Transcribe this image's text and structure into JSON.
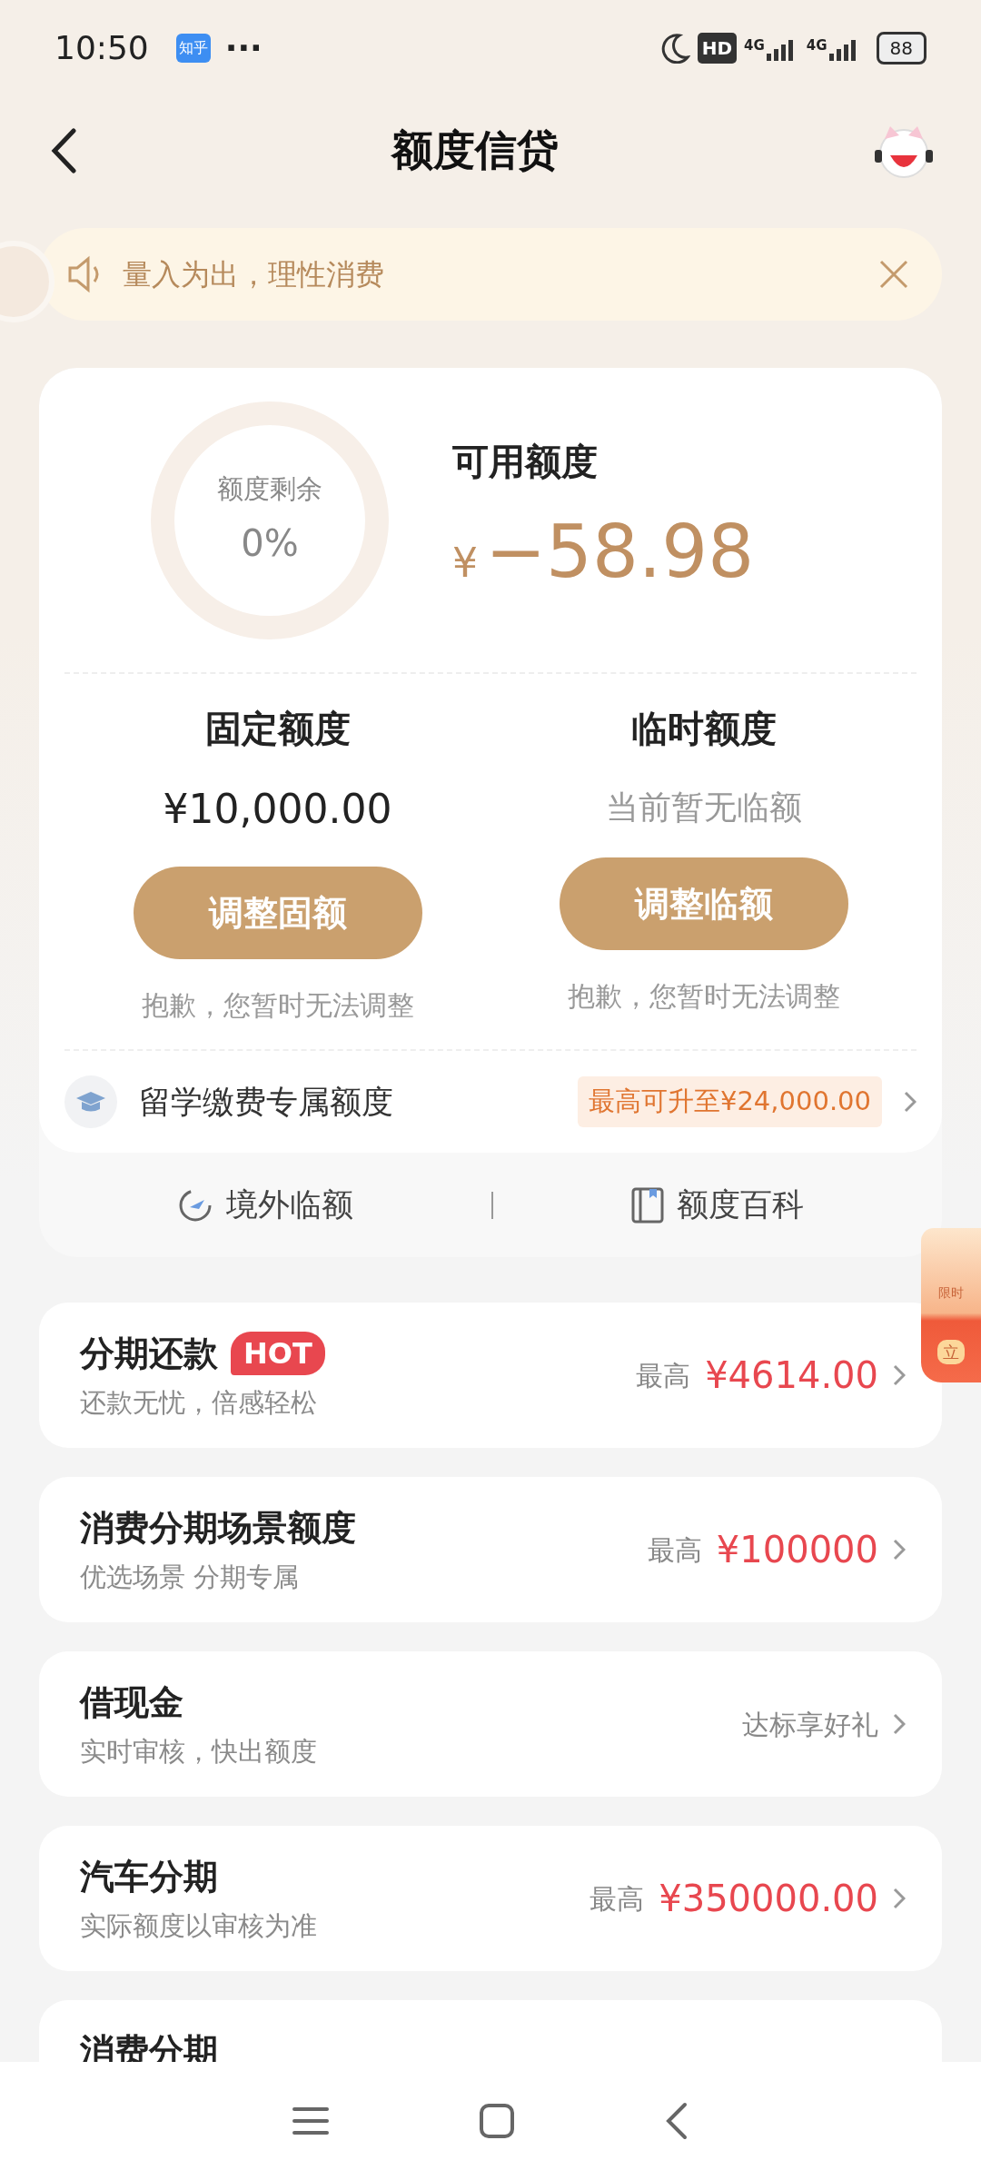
{
  "status_bar": {
    "time": "10:50",
    "app_badge": "知乎",
    "more": "···",
    "hd_label": "HD",
    "network_1": "4G",
    "network_2": "4G",
    "battery": "88"
  },
  "header": {
    "title": "额度信贷"
  },
  "notice": {
    "text": "量入为出，理性消费"
  },
  "quota_card": {
    "ring_label": "额度剩余",
    "ring_value": "0%",
    "level": 0,
    "available_label": "可用额度",
    "currency": "¥",
    "available_amount": "−58.98",
    "columns": [
      {
        "title": "固定额度",
        "value": "¥10,000.00",
        "kind": "amount",
        "button": "调整固额",
        "note": "抱歉，您暂时无法调整"
      },
      {
        "title": "临时额度",
        "value": "当前暂无临额",
        "kind": "hint",
        "button": "调整临额",
        "note": "抱歉，您暂时无法调整"
      }
    ],
    "study_row": {
      "label": "留学缴费专属额度",
      "tag": "最高可升至¥24,000.00"
    },
    "links": [
      {
        "label": "境外临额",
        "kind": "plane"
      },
      {
        "label": "额度百科",
        "kind": "book"
      }
    ]
  },
  "products": [
    {
      "title": "分期还款",
      "tag": "HOT",
      "subtitle": "还款无忧，倍感轻松",
      "kind": "amount",
      "prefix": "最高",
      "value": "¥4614.00"
    },
    {
      "title": "消费分期场景额度",
      "subtitle": "优选场景 分期专属",
      "kind": "amount",
      "prefix": "最高",
      "value": "¥100000"
    },
    {
      "title": "借现金",
      "subtitle": "实时审核，快出额度",
      "kind": "text",
      "value": "达标享好礼"
    },
    {
      "title": "汽车分期",
      "subtitle": "实际额度以审核为准",
      "kind": "amount",
      "prefix": "最高",
      "value": "¥350000.00"
    },
    {
      "title": "消费分期",
      "kind": "cut"
    }
  ],
  "promo_widget": {
    "line_1": "限时",
    "line_2": "立"
  }
}
